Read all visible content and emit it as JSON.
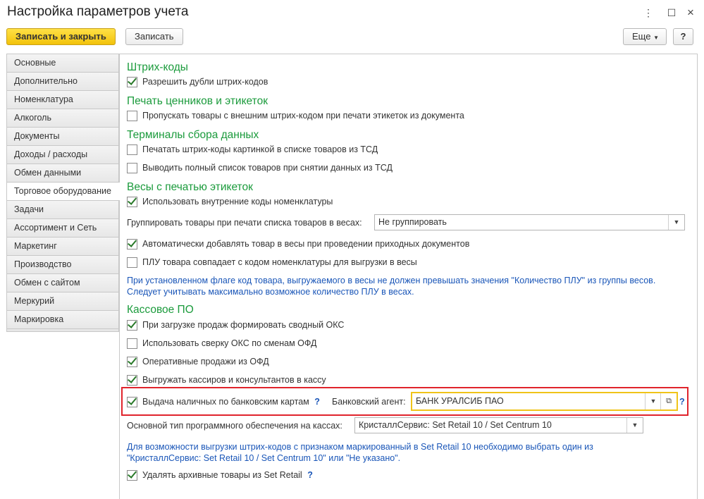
{
  "window": {
    "title": "Настройка параметров учета"
  },
  "toolbar": {
    "save_close": "Записать и закрыть",
    "save": "Записать",
    "more": "Еще",
    "help": "?"
  },
  "nav": [
    "Основные",
    "Дополнительно",
    "Номенклатура",
    "Алкоголь",
    "Документы",
    "Доходы / расходы",
    "Обмен данными",
    "Торговое оборудование",
    "Задачи",
    "Ассортимент и Сеть",
    "Маркетинг",
    "Производство",
    "Обмен с сайтом",
    "Меркурий",
    "Маркировка"
  ],
  "sections": {
    "barcodes": {
      "title": "Штрих-коды",
      "dup": "Разрешить дубли штрих-кодов"
    },
    "labels": {
      "title": "Печать ценников и этикеток",
      "skip": "Пропускать товары с внешним штрих-кодом при печати этикеток из документа"
    },
    "tsd": {
      "title": "Терминалы сбора данных",
      "print_pic": "Печатать штрих-коды картинкой в списке товаров из ТСД",
      "full_list": "Выводить полный список товаров при снятии данных из ТСД"
    },
    "scales": {
      "title": "Весы с печатью этикеток",
      "internal_codes": "Использовать внутренние коды номенклатуры",
      "group_label": "Группировать товары при печати списка товаров в весах:",
      "group_value": "Не группировать",
      "auto_add": "Автоматически добавлять товар в весы при проведении приходных документов",
      "plu": "ПЛУ товара совпадает с кодом номенклатуры для выгрузки в весы",
      "note1": "При установленном флаге код товара, выгружаемого в весы не должен превышать значения \"Количество ПЛУ\" из группы весов.",
      "note2": "Следует учитывать максимально возможное количество ПЛУ в весах."
    },
    "cash": {
      "title": "Кассовое ПО",
      "summary_oks": "При загрузке продаж формировать сводный ОКС",
      "reconcile": "Использовать сверку ОКС по сменам ОФД",
      "ofd_sales": "Оперативные продажи из ОФД",
      "cashiers": "Выгружать кассиров и консультантов в кассу",
      "cash_out": "Выдача наличных по банковским картам",
      "bank_agent_label": "Банковский агент:",
      "bank_agent_value": "БАНК УРАЛСИБ ПАО",
      "software_label": "Основной тип программного обеспечения на кассах:",
      "software_value": "КристаллСервис: Set Retail 10 / Set Centrum 10",
      "note1": "Для возможности выгрузки штрих-кодов с признаком маркированный в Set Retail 10 необходимо выбрать один из",
      "note2": "\"КристаллСервис: Set Retail 10 / Set Centrum 10\" или \"Не указано\".",
      "delete_archive": "Удалять архивные товары из Set Retail",
      "q": "?"
    }
  }
}
